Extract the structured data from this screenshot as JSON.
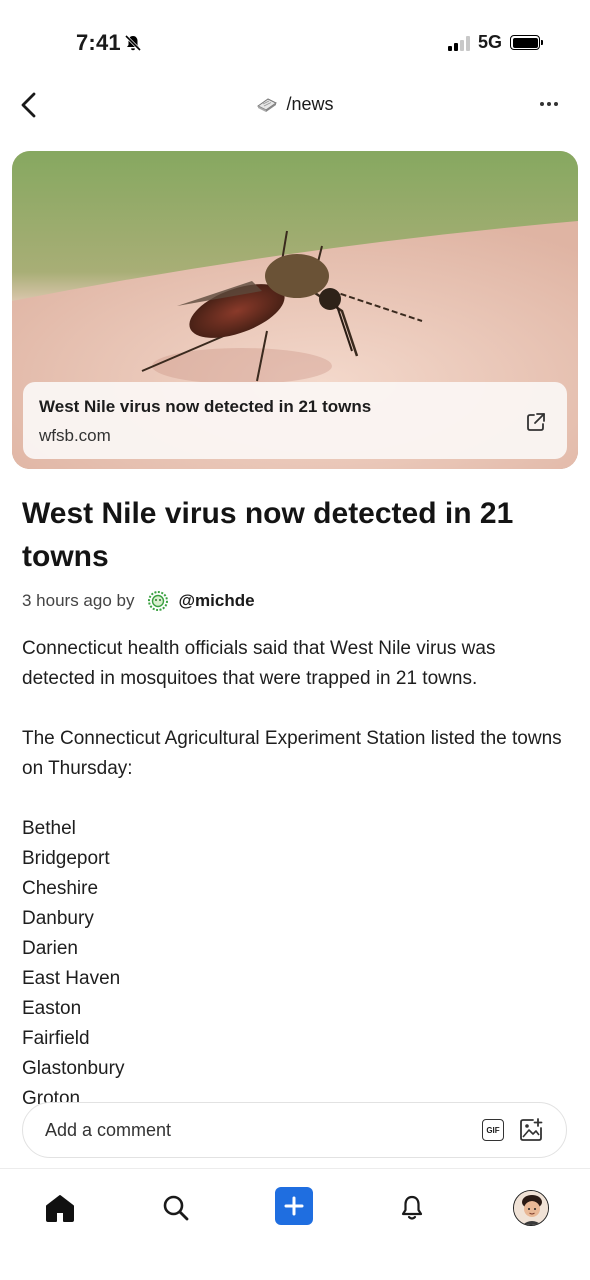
{
  "status_bar": {
    "time": "7:41",
    "network": "5G"
  },
  "nav": {
    "title": "/news"
  },
  "link_card": {
    "title": "West Nile virus now detected in 21 towns",
    "domain": "wfsb.com"
  },
  "article": {
    "title": "West Nile virus now detected in 21 towns",
    "byline_time": "3 hours ago by",
    "username": "@michde",
    "paragraphs": [
      "Connecticut health officials said that West Nile virus was detected in mosquitoes that were trapped in 21 towns.",
      "The Connecticut Agricultural Experiment Station listed the towns on Thursday:"
    ],
    "towns": [
      "Bethel",
      "Bridgeport",
      "Cheshire",
      "Danbury",
      "Darien",
      "East Haven",
      "Easton",
      "Fairfield",
      "Glastonbury",
      "Groton"
    ]
  },
  "comment_bar": {
    "placeholder": "Add a comment",
    "gif_label": "GIF"
  },
  "colors": {
    "accent": "#1f6ee0",
    "text": "#1a1a1a"
  },
  "icons": {
    "back": "chevron-left-icon",
    "more": "more-horizontal-icon",
    "external": "external-link-icon",
    "gif": "gif-icon",
    "image": "add-image-icon",
    "home": "home-icon",
    "search": "search-icon",
    "create": "plus-icon",
    "notifications": "bell-icon",
    "profile": "avatar"
  }
}
